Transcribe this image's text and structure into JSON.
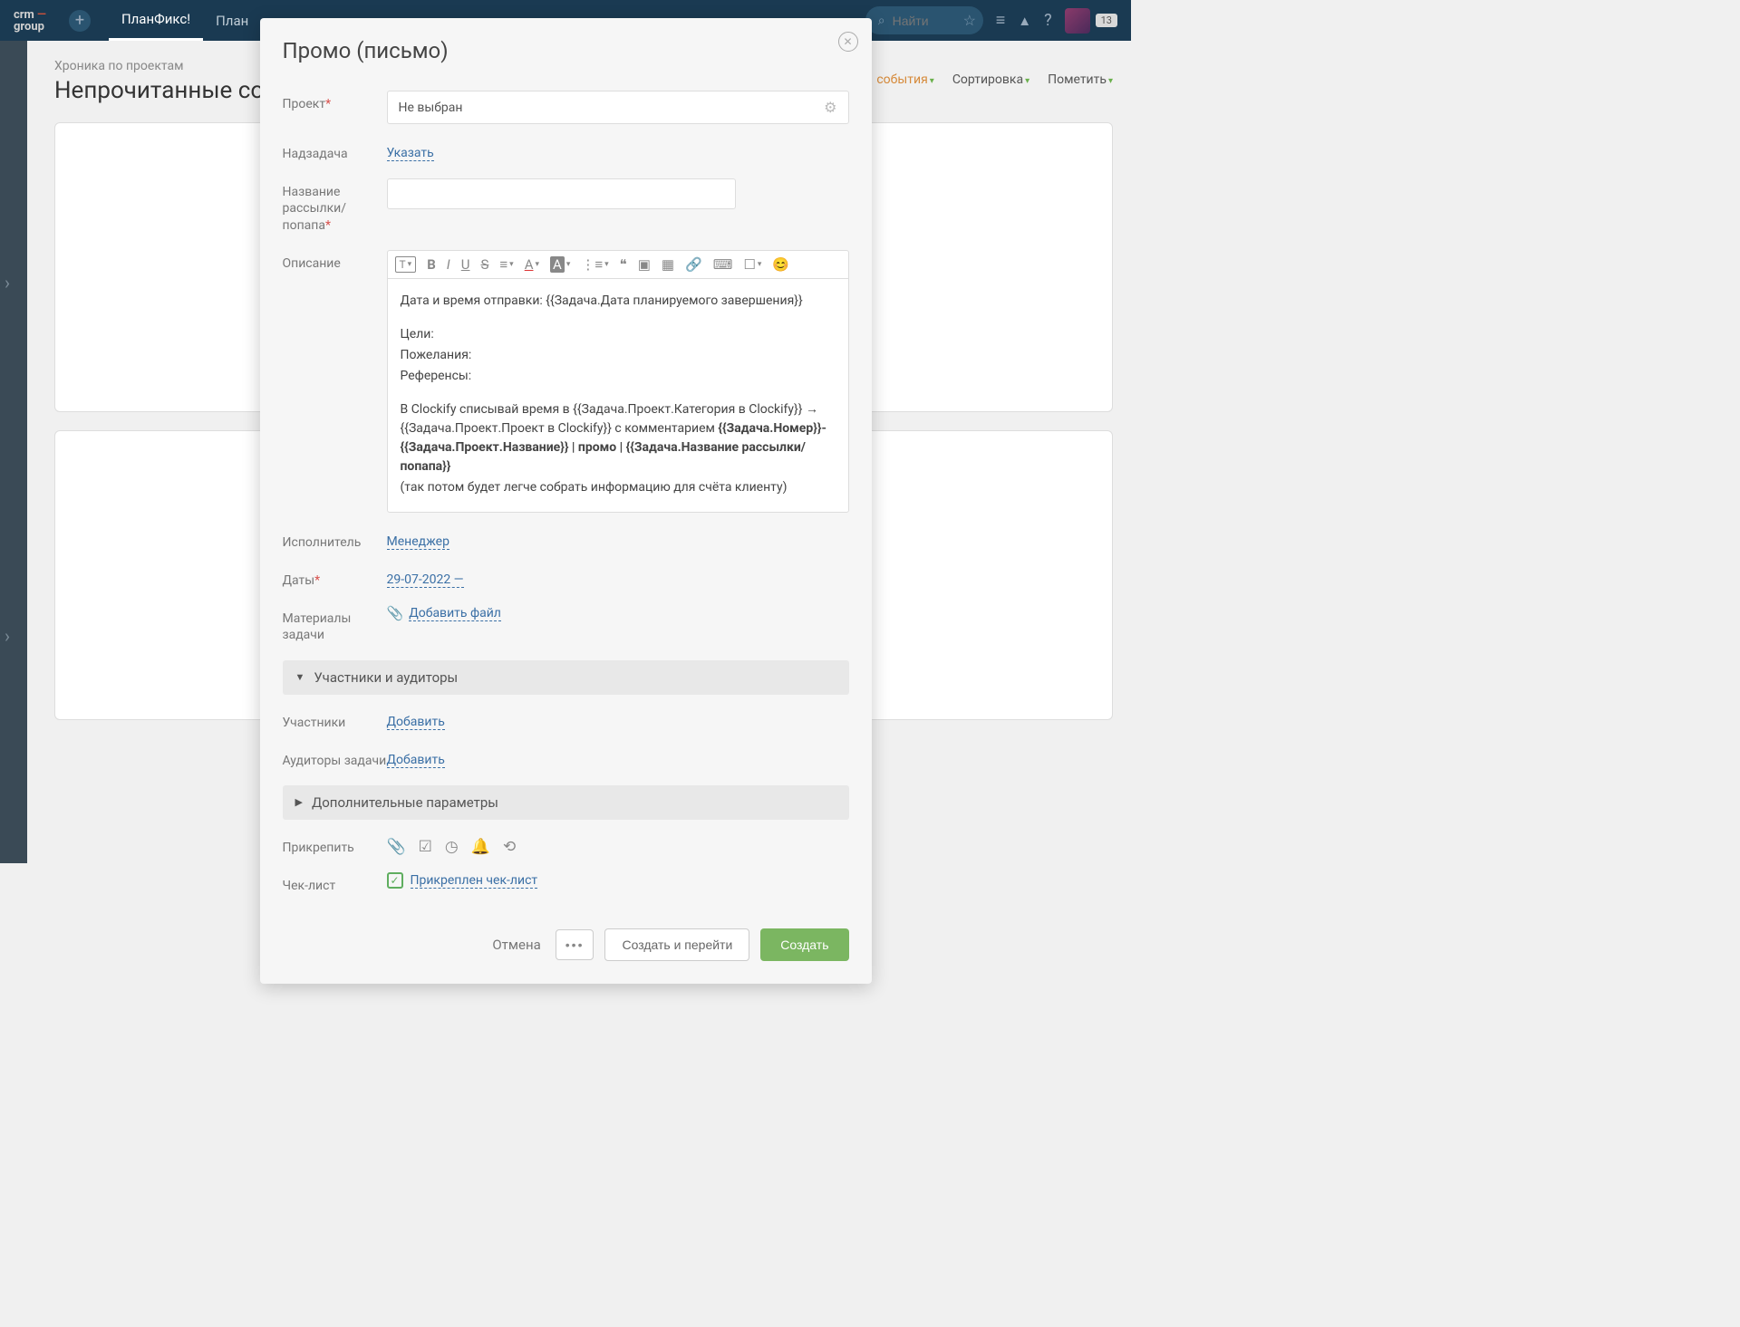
{
  "topbar": {
    "logo_l1": "crm",
    "logo_l2": "group",
    "nav": [
      "ПланФикс!",
      "План"
    ],
    "search_placeholder": "Найти",
    "badge": "13"
  },
  "page": {
    "breadcrumb": "Хроника по проектам",
    "title": "Непрочитанные со",
    "controls": {
      "events": "события",
      "sort": "Сортировка",
      "mark": "Пометить"
    }
  },
  "modal": {
    "title": "Промо (письмо)",
    "labels": {
      "project": "Проект",
      "supertask": "Надзадача",
      "mailing_name": "Название рассылки/попапа",
      "description": "Описание",
      "assignee": "Исполнитель",
      "dates": "Даты",
      "materials": "Материалы задачи",
      "participants_section": "Участники и аудиторы",
      "participants": "Участники",
      "auditors": "Аудиторы задачи",
      "extra_section": "Дополнительные параметры",
      "attach": "Прикрепить",
      "checklist": "Чек-лист"
    },
    "values": {
      "project": "Не выбран",
      "supertask": "Указать",
      "assignee": "Менеджер",
      "dates": "29-07-2022 —",
      "add_file": "Добавить файл",
      "add": "Добавить",
      "checklist_attached": "Прикреплен чек-лист"
    },
    "editor": {
      "l1": "Дата и время отправки: {{Задача.Дата планируемого завершения}}",
      "l2": "Цели:",
      "l3": "Пожелания:",
      "l4": "Референсы:",
      "l5a": "В Clockify списывай время в {{Задача.Проект.Категория в Clockify}} → {{Задача.Проект.Проект в Clockify}} с комментарием ",
      "l5b": "{{Задача.Номер}}-{{Задача.Проект.Название}} | промо | {{Задача.Название рассылки/попапа}}",
      "l6": "(так потом будет легче собрать информацию для счёта клиенту)"
    },
    "footer": {
      "cancel": "Отмена",
      "create_go": "Создать и перейти",
      "create": "Создать"
    }
  }
}
